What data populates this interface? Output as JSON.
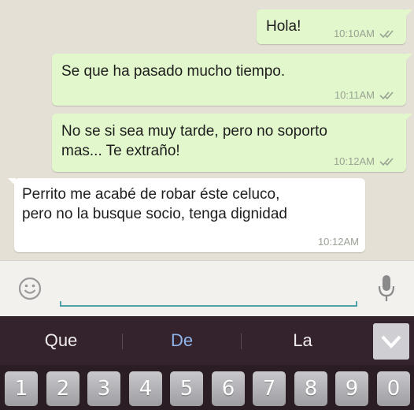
{
  "messages": [
    {
      "text": "Hola!",
      "time": "10:10AM",
      "direction": "outgoing",
      "status": "double-check-icon"
    },
    {
      "text": "Se que ha pasado mucho tiempo.",
      "time": "10:11AM",
      "direction": "outgoing",
      "status": "double-check-icon"
    },
    {
      "text": "No se si sea muy tarde, pero no soporto\nmas... Te extraño!",
      "time": "10:12AM",
      "direction": "outgoing",
      "status": "double-check-icon"
    },
    {
      "text": "Perrito me acabé de robar éste celuco,\npero no la busque socio, tenga dignidad",
      "time": "10:12AM",
      "direction": "incoming"
    }
  ],
  "composer": {
    "emoji_icon": "smiley-icon",
    "mic_icon": "microphone-icon"
  },
  "keyboard": {
    "suggestions": [
      "Que",
      "De",
      "La"
    ],
    "collapse_icon": "chevron-down-icon",
    "number_keys": [
      "1",
      "2",
      "3",
      "4",
      "5",
      "6",
      "7",
      "8",
      "9",
      "0"
    ]
  },
  "colors": {
    "outgoing_bubble": "#e2f7cb",
    "incoming_bubble": "#ffffff",
    "chat_background": "#e4e0d6",
    "keyboard_background": "#34232d",
    "highlight_suggestion": "#8fb4ea",
    "input_underline": "#4fa3a8"
  }
}
